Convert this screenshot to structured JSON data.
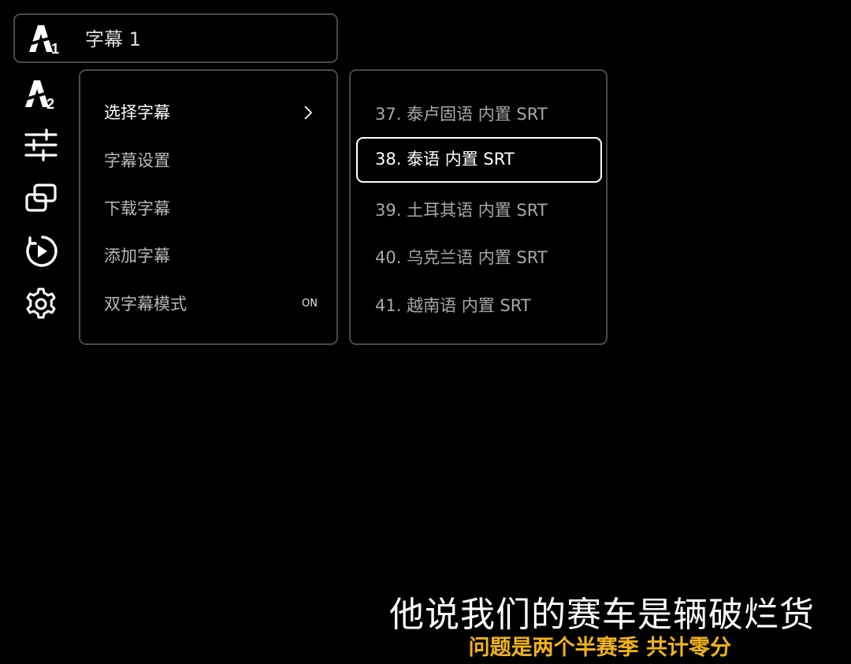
{
  "header": {
    "icon": "subtitle-track-1-icon",
    "title": "字幕 1"
  },
  "rail": [
    {
      "name": "subtitle-track-2-icon"
    },
    {
      "name": "sliders-icon"
    },
    {
      "name": "picture-in-picture-icon"
    },
    {
      "name": "playback-loop-icon"
    },
    {
      "name": "settings-gear-icon"
    }
  ],
  "menu": {
    "items": [
      {
        "label": "选择字幕",
        "trailing": "chevron-right-icon"
      },
      {
        "label": "字幕设置"
      },
      {
        "label": "下载字幕"
      },
      {
        "label": "添加字幕"
      },
      {
        "label": "双字幕模式",
        "status": "ON"
      }
    ]
  },
  "subtitle_list": {
    "items": [
      {
        "label": "37. 泰卢固语  内置 SRT"
      },
      {
        "label": "38. 泰语  内置 SRT",
        "selected": true
      },
      {
        "label": "39. 土耳其语  内置 SRT"
      },
      {
        "label": "40. 乌克兰语  内置 SRT"
      },
      {
        "label": "41. 越南语  内置 SRT"
      }
    ]
  },
  "subtitles": {
    "primary": "他说我们的赛车是辆破烂货",
    "secondary": "问题是两个半赛季 共计零分"
  },
  "colors": {
    "background": "#000000",
    "panel_border": "#4a4a4a",
    "secondary_subtitle": "#f0b31c"
  }
}
